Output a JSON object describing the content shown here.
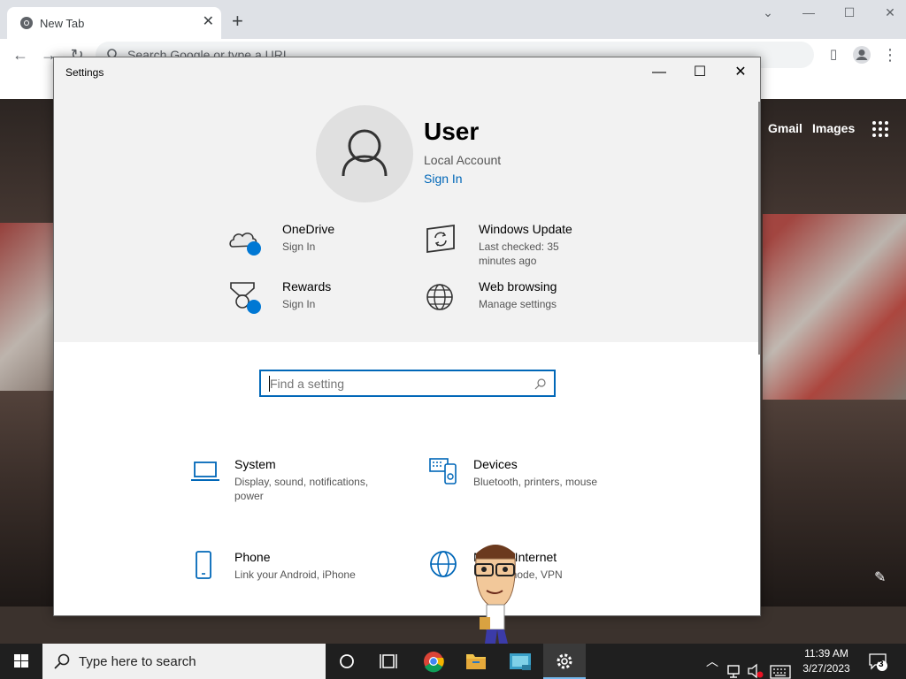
{
  "browser": {
    "tab_title": "New Tab",
    "omnibox_placeholder": "Search Google or type a URL",
    "ntp_links": [
      "Gmail",
      "Images"
    ]
  },
  "settings": {
    "window_title": "Settings",
    "user": {
      "name": "User",
      "account_type": "Local Account",
      "signin": "Sign In"
    },
    "quick_items": [
      {
        "title": "OneDrive",
        "sub": "Sign In",
        "icon": "cloud-icon"
      },
      {
        "title": "Windows Update",
        "sub": "Last checked: 35 minutes ago",
        "icon": "update-icon"
      },
      {
        "title": "Rewards",
        "sub": "Sign In",
        "icon": "medal-icon"
      },
      {
        "title": "Web browsing",
        "sub": "Manage settings",
        "icon": "globe-icon"
      }
    ],
    "search_placeholder": "Find a setting",
    "categories": [
      {
        "title": "System",
        "sub": "Display, sound, notifications, power",
        "icon": "laptop-icon"
      },
      {
        "title": "Devices",
        "sub": "Bluetooth, printers, mouse",
        "icon": "keyboard-icon"
      },
      {
        "title": "Phone",
        "sub": "Link your Android, iPhone",
        "icon": "phone-icon"
      },
      {
        "title": "N      & Internet",
        "sub": "    lane mode, VPN",
        "icon": "globe-icon"
      }
    ]
  },
  "taskbar": {
    "search_text": "Type here to search",
    "time": "11:39 AM",
    "date": "3/27/2023",
    "notification_count": "3"
  },
  "colors": {
    "accent": "#0067b8",
    "taskbar": "#1f1f1f",
    "settings_header": "#f2f2f2"
  }
}
